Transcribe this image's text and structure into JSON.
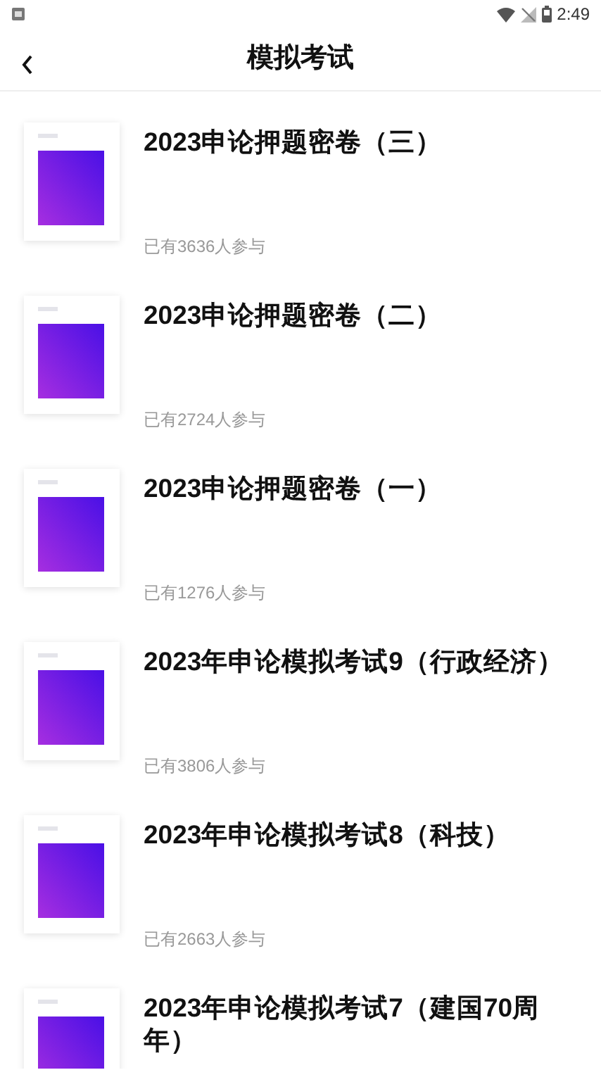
{
  "status_bar": {
    "time": "2:49"
  },
  "header": {
    "title": "模拟考试"
  },
  "exams": [
    {
      "title": "2023申论押题密卷（三）",
      "participants": "已有3636人参与"
    },
    {
      "title": "2023申论押题密卷（二）",
      "participants": "已有2724人参与"
    },
    {
      "title": "2023申论押题密卷（一）",
      "participants": "已有1276人参与"
    },
    {
      "title": "2023年申论模拟考试9（行政经济）",
      "participants": "已有3806人参与"
    },
    {
      "title": "2023年申论模拟考试8（科技）",
      "participants": "已有2663人参与"
    },
    {
      "title": "2023年申论模拟考试7（建国70周年）"
    }
  ]
}
